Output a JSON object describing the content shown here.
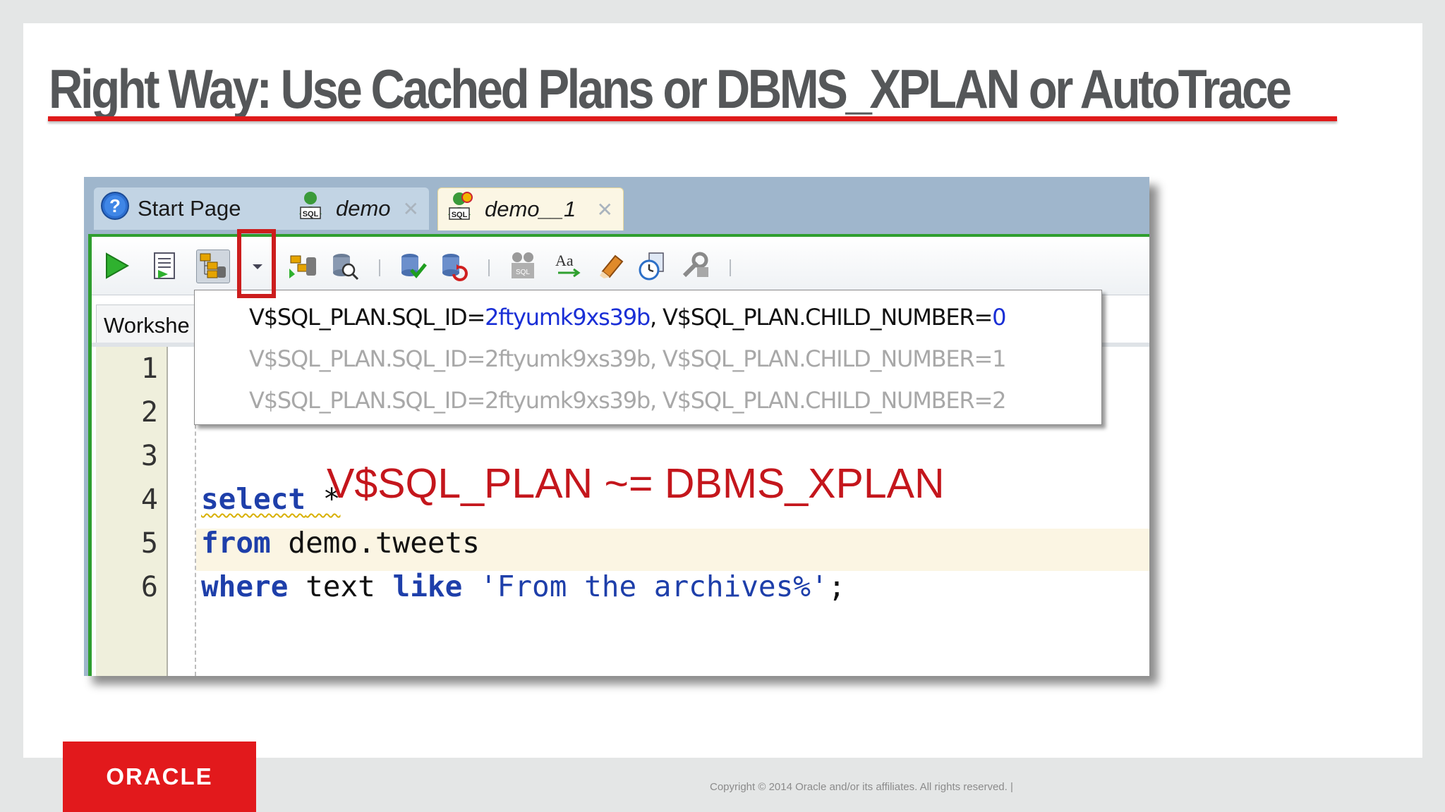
{
  "slide": {
    "title": "Right Way: Use Cached Plans or DBMS_XPLAN or AutoTrace",
    "copyright": "Copyright © 2014 Oracle and/or its affiliates. All rights reserved.  |",
    "logo_text": "ORACLE"
  },
  "ide": {
    "tabs": [
      {
        "label": "Start Page",
        "icon": "help-icon",
        "active": false
      },
      {
        "label": "demo",
        "icon": "sql-connection-icon",
        "active": false
      },
      {
        "label": "demo__1",
        "icon": "sql-connection-unshared-icon",
        "active": true
      }
    ],
    "worksheet_tab": "Workshe",
    "toolbar_icons": [
      "run-statement-icon",
      "run-script-icon",
      "explain-plan-icon",
      "explain-plan-dropdown-icon",
      "autotrace-icon",
      "sql-tuning-advisor-icon",
      "commit-icon",
      "rollback-icon",
      "unshared-sql-icon",
      "to-upper-lower-icon",
      "clear-icon",
      "sql-history-icon",
      "monitor-sql-icon"
    ],
    "line_numbers": [
      "1",
      "2",
      "3",
      "4",
      "5",
      "6"
    ],
    "code": {
      "line4_kw": "select",
      "line4_rest": " *",
      "line5_kw": "from",
      "line5_rest": " demo.tweets",
      "line6_kw1": "where",
      "line6_mid": " text ",
      "line6_kw2": "like",
      "line6_sp": " ",
      "line6_str": "'From the archives%'",
      "line6_end": ";"
    },
    "annotation": "V$SQL_PLAN ~= DBMS_XPLAN"
  },
  "dropdown": {
    "items": [
      {
        "prefix": "V$SQL_PLAN.SQL_ID=",
        "sql_id": "2ftyumk9xs39b",
        "mid": ", V$SQL_PLAN.CHILD_NUMBER=",
        "child": "0",
        "enabled": true
      },
      {
        "text": "V$SQL_PLAN.SQL_ID=2ftyumk9xs39b, V$SQL_PLAN.CHILD_NUMBER=1",
        "enabled": false
      },
      {
        "text": "V$SQL_PLAN.SQL_ID=2ftyumk9xs39b, V$SQL_PLAN.CHILD_NUMBER=2",
        "enabled": false
      }
    ]
  },
  "colors": {
    "title_rule": "#e01b1b",
    "annotation": "#c4161c",
    "keyword": "#1e3faa",
    "highlight_box": "#cc1d1d",
    "oracle_red": "#e2191c"
  }
}
